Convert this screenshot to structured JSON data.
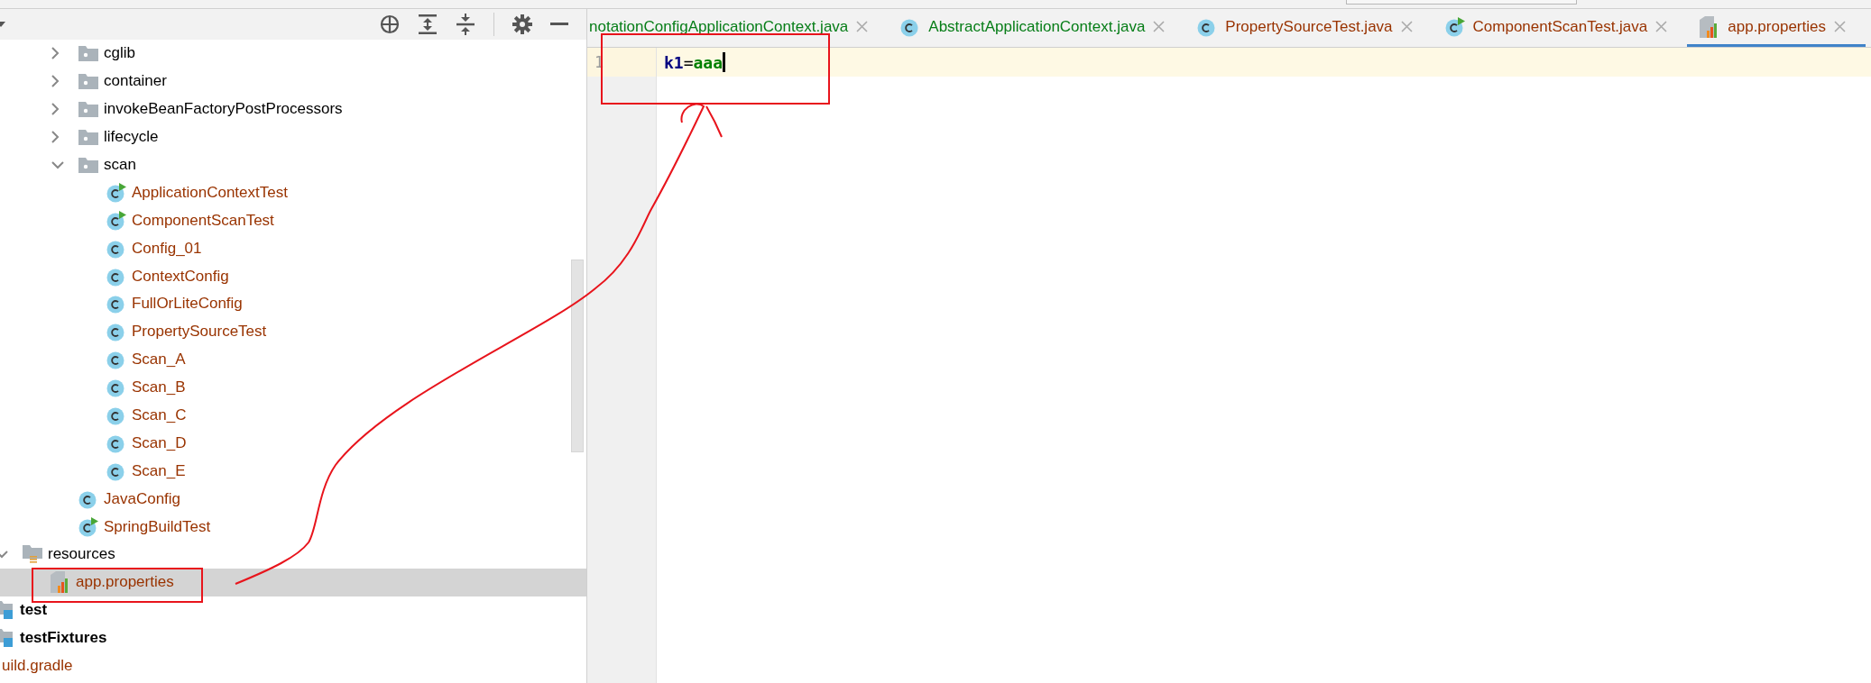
{
  "toolbar": {
    "buttons": [
      {
        "kind": "locate"
      },
      {
        "kind": "expand-all"
      },
      {
        "kind": "collapse-all"
      },
      {
        "kind": "settings"
      },
      {
        "kind": "hide"
      }
    ]
  },
  "tree": [
    {
      "kind": "group",
      "children": [
        {
          "kind": "group",
          "children": [
            {
              "kind": "group",
              "children": [
                {
                  "kind": "group",
                  "children": [
                    {
                      "label": "cglib",
                      "kind": "package",
                      "color": "#000000",
                      "expanded": false,
                      "selected": false
                    },
                    {
                      "label": "container",
                      "kind": "package",
                      "color": "#000000",
                      "expanded": false,
                      "selected": false
                    },
                    {
                      "label": "invokeBeanFactoryPostProcessors",
                      "kind": "package",
                      "color": "#000000",
                      "expanded": false,
                      "selected": false
                    },
                    {
                      "label": "lifecycle",
                      "kind": "package",
                      "color": "#000000",
                      "expanded": false,
                      "selected": false
                    },
                    {
                      "label": "scan",
                      "kind": "package",
                      "color": "#000000",
                      "expanded": true,
                      "selected": false,
                      "children": [
                        {
                          "label": "ApplicationContextTest",
                          "kind": "test-class",
                          "color": "#993300",
                          "selected": false
                        },
                        {
                          "label": "ComponentScanTest",
                          "kind": "test-class",
                          "color": "#993300",
                          "selected": false
                        },
                        {
                          "label": "Config_01",
                          "kind": "class",
                          "color": "#993300",
                          "selected": false
                        },
                        {
                          "label": "ContextConfig",
                          "kind": "class",
                          "color": "#993300",
                          "selected": false
                        },
                        {
                          "label": "FullOrLiteConfig",
                          "kind": "class",
                          "color": "#993300",
                          "selected": false
                        },
                        {
                          "label": "PropertySourceTest",
                          "kind": "class",
                          "color": "#993300",
                          "selected": false
                        },
                        {
                          "label": "Scan_A",
                          "kind": "class",
                          "color": "#993300",
                          "selected": false
                        },
                        {
                          "label": "Scan_B",
                          "kind": "class",
                          "color": "#993300",
                          "selected": false
                        },
                        {
                          "label": "Scan_C",
                          "kind": "class",
                          "color": "#993300",
                          "selected": false
                        },
                        {
                          "label": "Scan_D",
                          "kind": "class",
                          "color": "#993300",
                          "selected": false
                        },
                        {
                          "label": "Scan_E",
                          "kind": "class",
                          "color": "#993300",
                          "selected": false
                        }
                      ]
                    },
                    {
                      "label": "JavaConfig",
                      "kind": "class",
                      "color": "#993300",
                      "selected": false
                    },
                    {
                      "label": "SpringBuildTest",
                      "kind": "test-class",
                      "color": "#993300",
                      "selected": false
                    }
                  ]
                }
              ]
            },
            {
              "label": "resources",
              "kind": "resources-root",
              "color": "#000000",
              "expanded": true,
              "selected": false,
              "children": [
                {
                  "label": "app.properties",
                  "kind": "properties",
                  "color": "#993300",
                  "selected": true
                }
              ]
            }
          ]
        },
        {
          "label": "test",
          "kind": "test-root",
          "color": "#000000",
          "selected": false
        },
        {
          "label": "testFixtures",
          "kind": "test-root",
          "color": "#000000",
          "selected": false
        }
      ]
    },
    {
      "label": "uild.gradle",
      "kind": "gradle",
      "color": "#993300",
      "selected": false
    }
  ],
  "tabs": [
    {
      "label": "notationConfigApplicationContext.java",
      "color": "#067d17",
      "selected": false
    },
    {
      "label": "AbstractApplicationContext.java",
      "kind": "class",
      "color": "#067d17",
      "selected": false
    },
    {
      "label": "PropertySourceTest.java",
      "kind": "class",
      "color": "#993300",
      "selected": false
    },
    {
      "label": "ComponentScanTest.java",
      "kind": "test-class",
      "color": "#993300",
      "selected": false
    },
    {
      "label": "app.properties",
      "kind": "properties",
      "color": "#993300",
      "selected": true
    }
  ],
  "editor": {
    "lines": [
      {
        "number": "1",
        "current": true,
        "key": "k1",
        "separator": "=",
        "value": "aaa"
      }
    ]
  }
}
